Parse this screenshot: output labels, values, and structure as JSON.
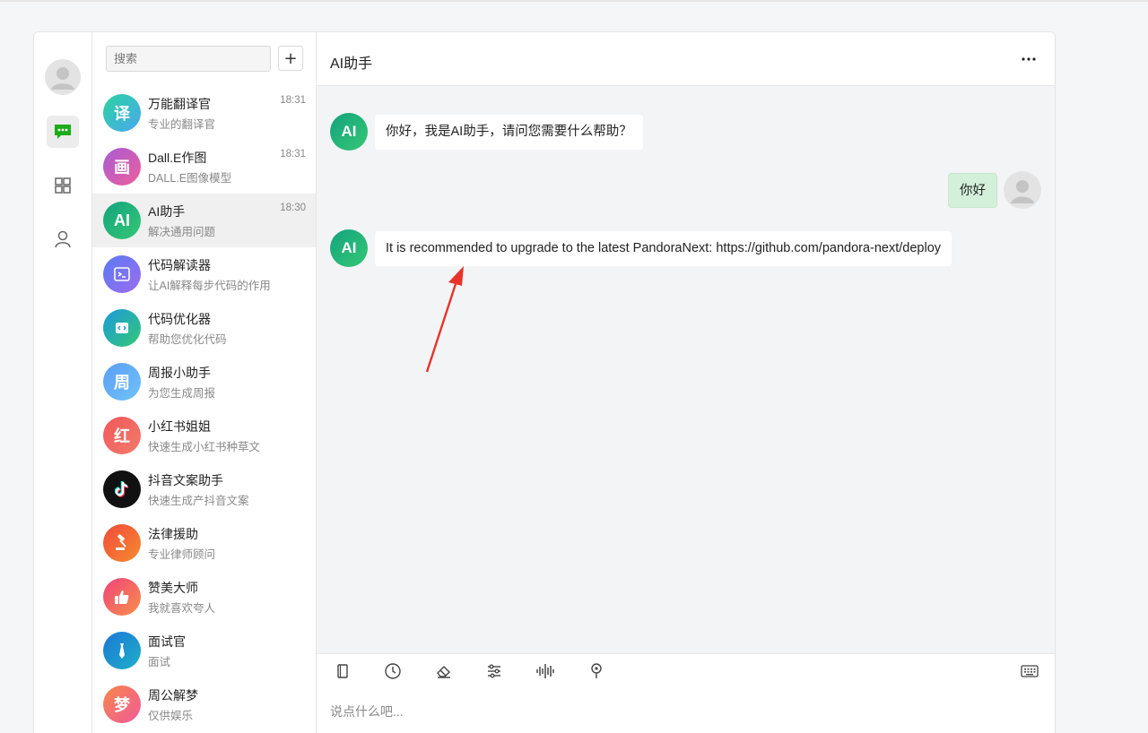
{
  "search": {
    "placeholder": "搜索"
  },
  "add_button": "+",
  "conversations": [
    {
      "name": "万能翻译官",
      "sub": "专业的翻译官",
      "time": "18:31",
      "avatar_text": "译",
      "icon": "translate-icon"
    },
    {
      "name": "Dall.E作图",
      "sub": "DALL.E图像模型",
      "time": "18:31",
      "avatar_text": "画",
      "icon": "painting-icon"
    },
    {
      "name": "AI助手",
      "sub": "解决通用问题",
      "time": "18:30",
      "avatar_text": "AI",
      "icon": "ai-icon"
    },
    {
      "name": "代码解读器",
      "sub": "让AI解释每步代码的作用",
      "time": "",
      "avatar_text": "",
      "icon": "terminal-icon"
    },
    {
      "name": "代码优化器",
      "sub": "帮助您优化代码",
      "time": "",
      "avatar_text": "",
      "icon": "code-icon"
    },
    {
      "name": "周报小助手",
      "sub": "为您生成周报",
      "time": "",
      "avatar_text": "周",
      "icon": "weekly-report-icon"
    },
    {
      "name": "小红书姐姐",
      "sub": "快速生成小红书种草文",
      "time": "",
      "avatar_text": "红",
      "icon": "xiaohongshu-icon"
    },
    {
      "name": "抖音文案助手",
      "sub": "快速生成产抖音文案",
      "time": "",
      "avatar_text": "",
      "icon": "tiktok-icon"
    },
    {
      "name": "法律援助",
      "sub": "专业律师顾问",
      "time": "",
      "avatar_text": "",
      "icon": "gavel-icon"
    },
    {
      "name": "赞美大师",
      "sub": "我就喜欢夸人",
      "time": "",
      "avatar_text": "",
      "icon": "thumbs-up-icon"
    },
    {
      "name": "面试官",
      "sub": "面试",
      "time": "",
      "avatar_text": "",
      "icon": "necktie-icon"
    },
    {
      "name": "周公解梦",
      "sub": "仅供娱乐",
      "time": "",
      "avatar_text": "梦",
      "icon": "dream-icon"
    }
  ],
  "chat": {
    "title": "AI助手",
    "ai_avatar_text": "AI",
    "messages": [
      {
        "from": "ai",
        "text": "你好，我是AI助手，请问您需要什么帮助？"
      },
      {
        "from": "user",
        "text": "你好"
      },
      {
        "from": "ai",
        "text": "It is recommended to upgrade to the latest PandoraNext: https://github.com/pandora-next/deploy"
      }
    ],
    "input_placeholder": "说点什么吧..."
  },
  "colors": {
    "accent_green": "#1aad19",
    "annotation_arrow": "#e8332b",
    "user_bubble": "#d3f0db",
    "chat_bg": "#f3f4f6"
  },
  "toolbar_icons": [
    "notebook-icon",
    "clock-icon",
    "eraser-icon",
    "sliders-icon",
    "voice-wave-icon",
    "location-pin-icon",
    "keyboard-icon"
  ]
}
